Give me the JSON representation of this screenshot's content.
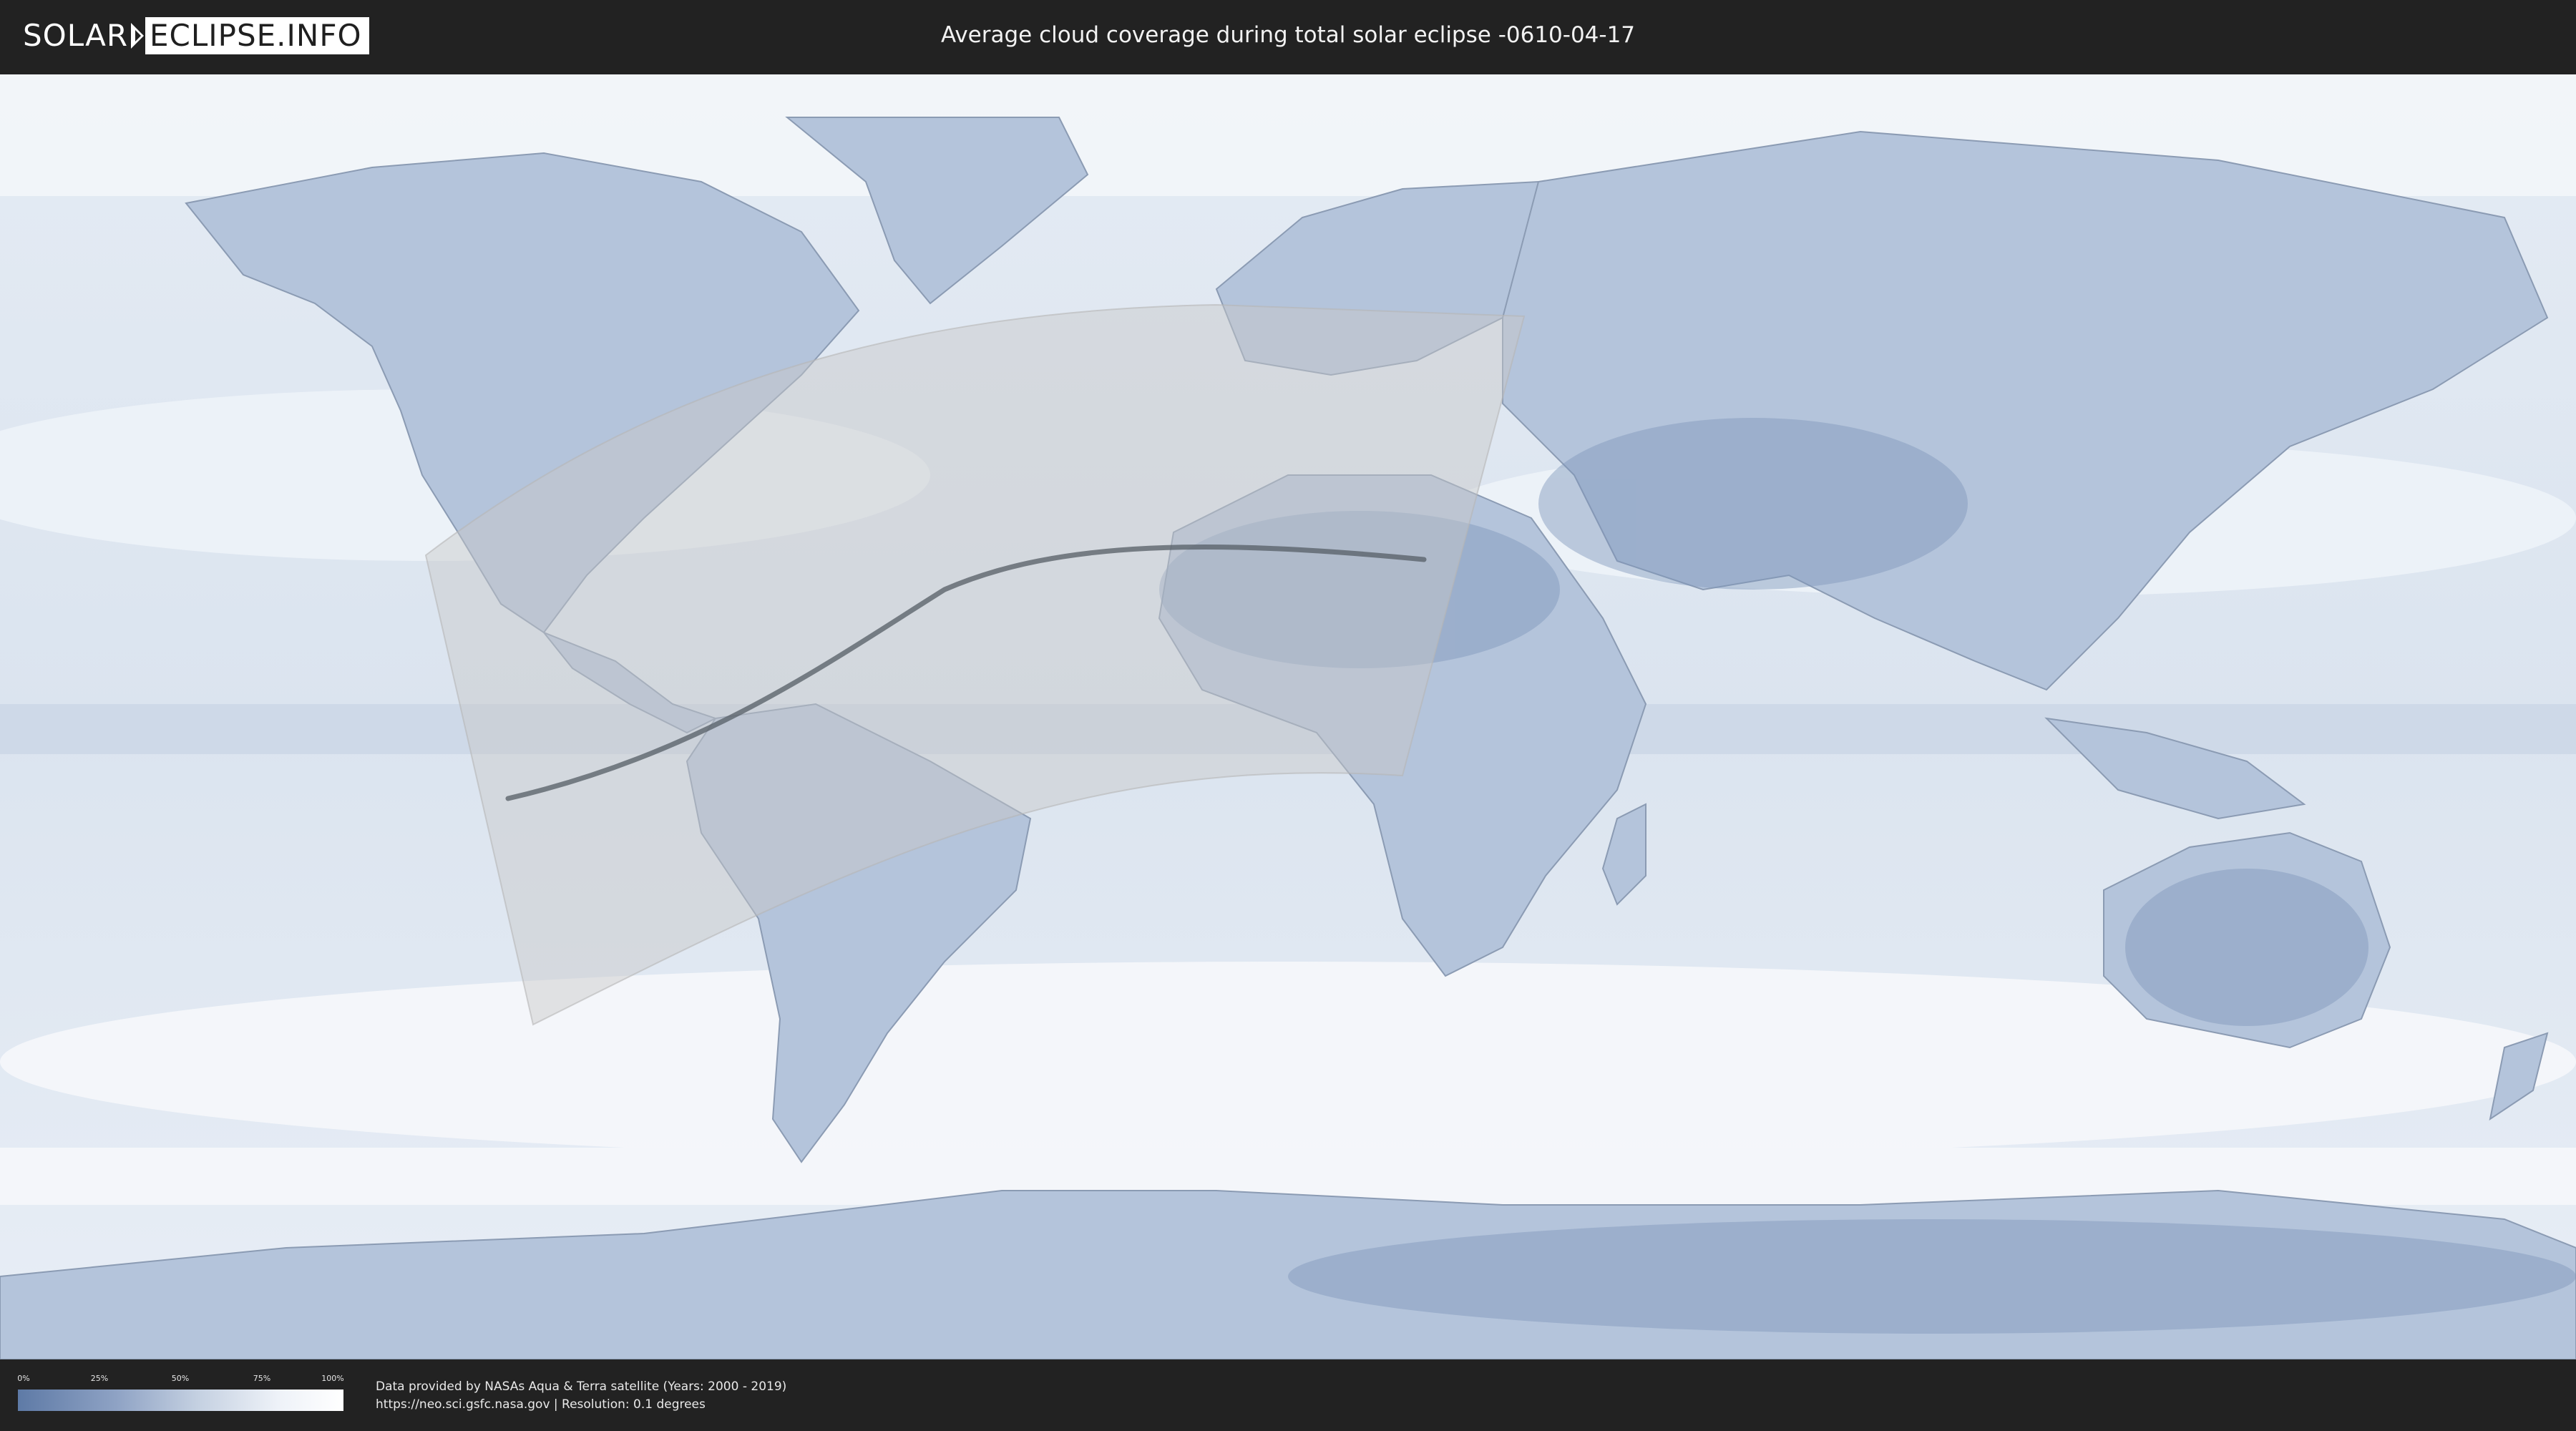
{
  "header": {
    "logo_left": "SOLAR",
    "logo_right": "ECLIPSE.INFO",
    "title": "Average cloud coverage during total solar eclipse -0610-04-17"
  },
  "map": {
    "ocean_color": "#d9e2ee",
    "land_color": "#a9bcd6",
    "cloud_color": "#f4f7fb",
    "visibility_zone_color": "#c8c8c8",
    "path_color": "#555d66"
  },
  "legend": {
    "ticks": [
      "0%",
      "25%",
      "50%",
      "75%",
      "100%"
    ],
    "gradient_low": "#5e7aa6",
    "gradient_high": "#ffffff"
  },
  "footer": {
    "line1": "Data provided by NASAs Aqua & Terra satellite (Years: 2000 - 2019)",
    "line2": "https://neo.sci.gsfc.nasa.gov | Resolution: 0.1 degrees"
  }
}
